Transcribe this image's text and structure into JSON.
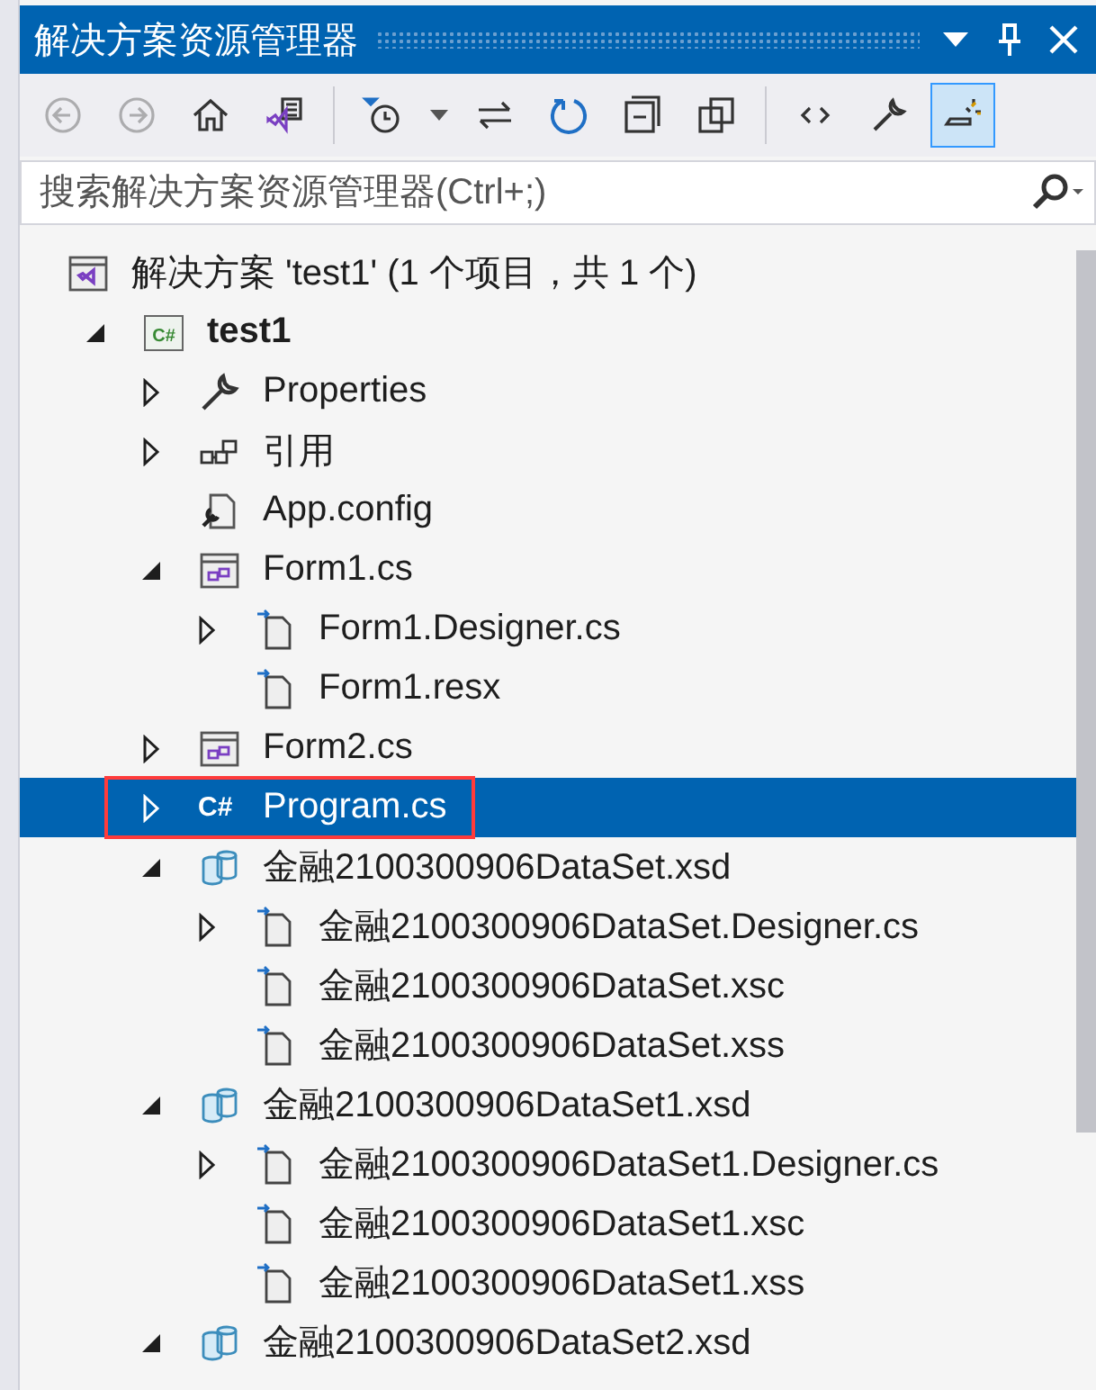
{
  "window": {
    "title": "解决方案资源管理器"
  },
  "toolbar": [
    {
      "kind": "back",
      "disabled": true,
      "active": false
    },
    {
      "kind": "forward",
      "disabled": true,
      "active": false
    },
    {
      "kind": "home",
      "disabled": false,
      "active": false
    },
    {
      "kind": "switch-views",
      "disabled": false,
      "active": false
    },
    {
      "kind": "separator"
    },
    {
      "kind": "pending-filter",
      "disabled": false,
      "active": false
    },
    {
      "kind": "dropdown"
    },
    {
      "kind": "sync",
      "disabled": false,
      "active": false
    },
    {
      "kind": "refresh",
      "disabled": false,
      "active": false
    },
    {
      "kind": "collapse",
      "disabled": false,
      "active": false
    },
    {
      "kind": "show-all",
      "disabled": false,
      "active": false
    },
    {
      "kind": "separator"
    },
    {
      "kind": "code",
      "disabled": false,
      "active": false
    },
    {
      "kind": "properties",
      "disabled": false,
      "active": false
    },
    {
      "kind": "preview",
      "disabled": false,
      "active": true
    }
  ],
  "search": {
    "placeholder": "搜索解决方案资源管理器(Ctrl+;)"
  },
  "solution": {
    "label": "解决方案 'test1' (1 个项目，共 1 个)"
  },
  "tree": [
    {
      "label": "test1",
      "kind": "csproj",
      "badge": "C#",
      "bold": true,
      "expanded": true,
      "selected": false,
      "outlined": false,
      "children": [
        {
          "label": "Properties",
          "kind": "wrench",
          "bold": false,
          "expanded": false,
          "selected": false,
          "outlined": false
        },
        {
          "label": "引用",
          "kind": "references",
          "bold": false,
          "expanded": false,
          "selected": false,
          "outlined": false
        },
        {
          "label": "App.config",
          "kind": "config",
          "bold": false,
          "selected": false,
          "outlined": false
        },
        {
          "label": "Form1.cs",
          "kind": "form",
          "bold": false,
          "expanded": true,
          "selected": false,
          "outlined": false,
          "children": [
            {
              "label": "Form1.Designer.cs",
              "kind": "file",
              "bold": false,
              "expanded": false,
              "selected": false,
              "outlined": false
            },
            {
              "label": "Form1.resx",
              "kind": "file",
              "bold": false,
              "selected": false,
              "outlined": false
            }
          ]
        },
        {
          "label": "Form2.cs",
          "kind": "form",
          "bold": false,
          "expanded": false,
          "selected": false,
          "outlined": false
        },
        {
          "label": "Program.cs",
          "kind": "csharp",
          "badge": "C#",
          "bold": false,
          "expanded": false,
          "selected": true,
          "outlined": true
        },
        {
          "label": "金融2100300906DataSet.xsd",
          "kind": "dataset",
          "bold": false,
          "expanded": true,
          "selected": false,
          "outlined": false,
          "children": [
            {
              "label": "金融2100300906DataSet.Designer.cs",
              "kind": "file",
              "bold": false,
              "expanded": false,
              "selected": false,
              "outlined": false
            },
            {
              "label": "金融2100300906DataSet.xsc",
              "kind": "file",
              "bold": false,
              "selected": false,
              "outlined": false
            },
            {
              "label": "金融2100300906DataSet.xss",
              "kind": "file",
              "bold": false,
              "selected": false,
              "outlined": false
            }
          ]
        },
        {
          "label": "金融2100300906DataSet1.xsd",
          "kind": "dataset",
          "bold": false,
          "expanded": true,
          "selected": false,
          "outlined": false,
          "children": [
            {
              "label": "金融2100300906DataSet1.Designer.cs",
              "kind": "file",
              "bold": false,
              "expanded": false,
              "selected": false,
              "outlined": false
            },
            {
              "label": "金融2100300906DataSet1.xsc",
              "kind": "file",
              "bold": false,
              "selected": false,
              "outlined": false
            },
            {
              "label": "金融2100300906DataSet1.xss",
              "kind": "file",
              "bold": false,
              "selected": false,
              "outlined": false
            }
          ]
        },
        {
          "label": "金融2100300906DataSet2.xsd",
          "kind": "dataset",
          "bold": false,
          "expanded": true,
          "selected": false,
          "outlined": false
        }
      ]
    }
  ]
}
